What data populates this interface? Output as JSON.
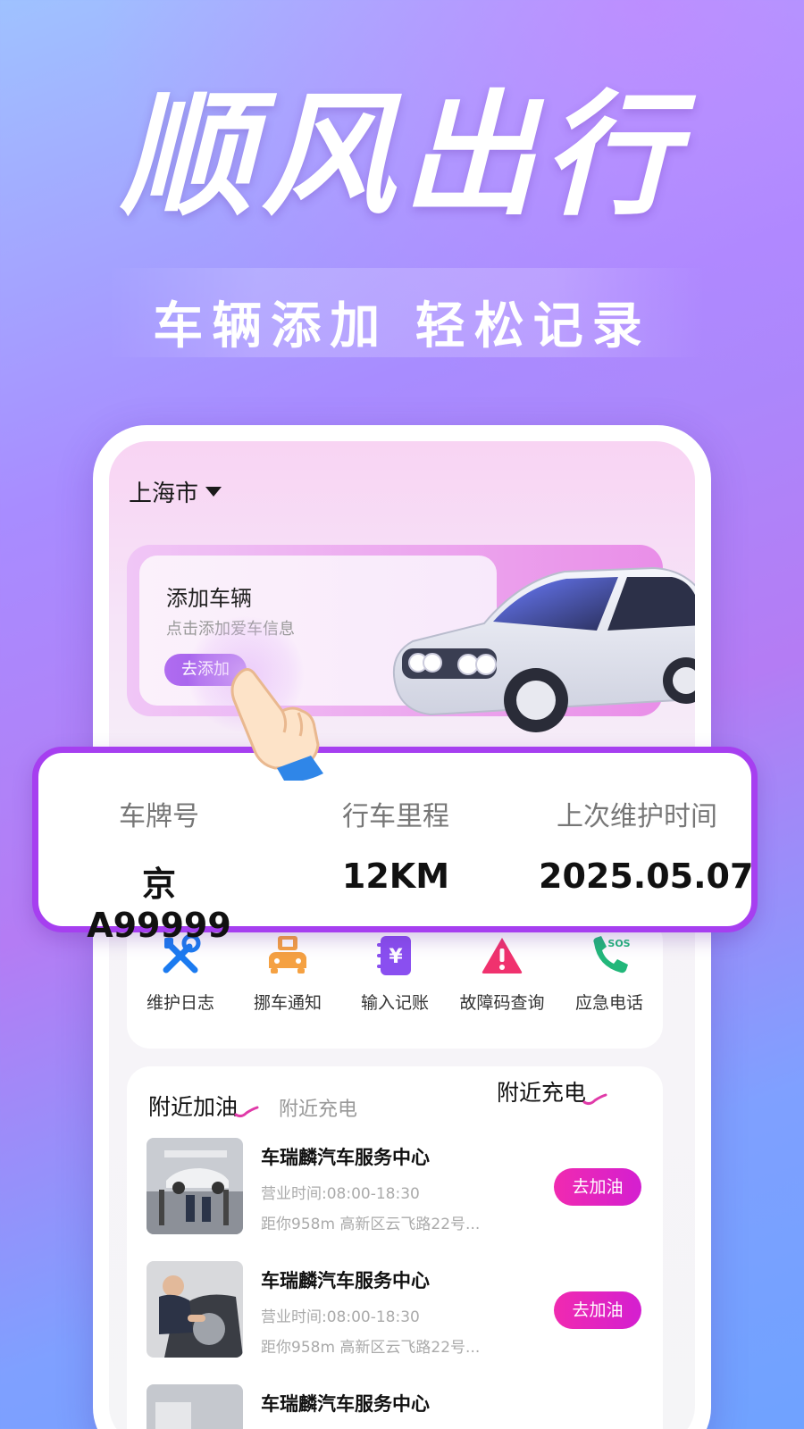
{
  "hero": {
    "title": "顺风出行",
    "subtitle": "车辆添加 轻松记录"
  },
  "phone": {
    "city": "上海市",
    "add_vehicle": {
      "title": "添加车辆",
      "hint": "点击添加爱车信息",
      "button": "去添加"
    },
    "vehicle_info": {
      "plate_label": "车牌号",
      "plate_value": "京A99999",
      "mileage_label": "行车里程",
      "mileage_value": "12KM",
      "maintenance_label": "上次维护时间",
      "maintenance_value": "2025.05.07"
    },
    "tools": [
      {
        "label": "维护日志",
        "icon": "wrench-screwdriver-icon"
      },
      {
        "label": "挪车通知",
        "icon": "car-notice-icon"
      },
      {
        "label": "输入记账",
        "icon": "yuan-ledger-icon"
      },
      {
        "label": "故障码查询",
        "icon": "warning-icon"
      },
      {
        "label": "应急电话",
        "icon": "sos-phone-icon"
      }
    ],
    "nearby": {
      "tab_active": "附近加油",
      "tab_inactive": "附近充电",
      "tab_overlay": "附近充电",
      "shops": [
        {
          "name": "车瑞麟汽车服务中心",
          "hours": "营业时间:08:00-18:30",
          "distance": "距你958m   高新区云飞路22号...",
          "button": "去加油"
        },
        {
          "name": "车瑞麟汽车服务中心",
          "hours": "营业时间:08:00-18:30",
          "distance": "距你958m   高新区云飞路22号...",
          "button": "去加油"
        },
        {
          "name": "车瑞麟汽车服务中心",
          "hours": "",
          "distance": "",
          "button": ""
        }
      ]
    }
  },
  "colors": {
    "accent_purple": "#a63ff0",
    "button_magenta": "#f02ab0"
  }
}
